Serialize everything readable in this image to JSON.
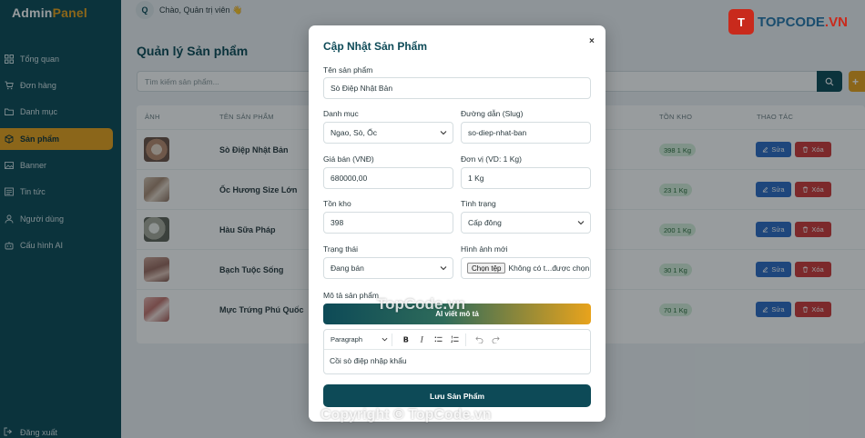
{
  "brand": {
    "part1": "Admin",
    "part2": "Panel"
  },
  "sidebar": {
    "items": [
      {
        "label": "Tổng quan",
        "icon": "grid-icon"
      },
      {
        "label": "Đơn hàng",
        "icon": "cart-icon"
      },
      {
        "label": "Danh mục",
        "icon": "folder-icon"
      },
      {
        "label": "Sản phẩm",
        "icon": "box-icon",
        "active": true
      },
      {
        "label": "Banner",
        "icon": "image-icon"
      },
      {
        "label": "Tin tức",
        "icon": "news-icon"
      },
      {
        "label": "Người dùng",
        "icon": "users-icon"
      },
      {
        "label": "Cấu hình AI",
        "icon": "robot-icon"
      }
    ],
    "logout_label": "Đăng xuất"
  },
  "header": {
    "avatar_initial": "Q",
    "greeting": "Chào, Quản trị viên 👋"
  },
  "main": {
    "title": "Quản lý Sản phẩm",
    "search_placeholder": "Tìm kiếm sản phẩm...",
    "add_label": "+",
    "columns": {
      "image": "ẢNH",
      "name": "TÊN SẢN PHẨM",
      "stock": "TỒN KHO",
      "actions": "THAO TÁC"
    },
    "edit_label": "Sửa",
    "delete_label": "Xóa",
    "rows": [
      {
        "name": "Sò Điệp Nhật Bản",
        "stock": "398 1 Kg"
      },
      {
        "name": "Ốc Hương Size Lớn",
        "stock": "23 1 Kg"
      },
      {
        "name": "Hàu Sữa Pháp",
        "stock": "200 1 Kg"
      },
      {
        "name": "Bạch Tuộc Sống",
        "stock": "30 1 Kg"
      },
      {
        "name": "Mực Trứng Phú Quốc",
        "stock": "70 1 Kg"
      }
    ]
  },
  "modal": {
    "title": "Cập Nhật Sản Phẩm",
    "close": "×",
    "name_label": "Tên sản phẩm",
    "name_value": "Sò Điệp Nhật Bản",
    "category_label": "Danh mục",
    "category_value": "Ngao, Sò, Ốc",
    "slug_label": "Đường dẫn (Slug)",
    "slug_value": "so-diep-nhat-ban",
    "price_label": "Giá bán (VNĐ)",
    "price_value": "680000,00",
    "unit_label": "Đơn vị (VD: 1 Kg)",
    "unit_value": "1 Kg",
    "stock_label": "Tồn kho",
    "stock_value": "398",
    "condition_label": "Tình trạng",
    "condition_value": "Cấp đông",
    "status_label": "Trạng thái",
    "status_value": "Đang bán",
    "image_label": "Hình ảnh mới",
    "file_button": "Chọn tệp",
    "file_text": "Không có t...được chọn",
    "desc_label": "Mô tả sản phẩm",
    "ai_button": "AI viết mô tả",
    "editor_format": "Paragraph",
    "editor_content": "Cồi sò điệp nhập khẩu",
    "save_button": "Lưu Sản Phẩm"
  },
  "watermark": {
    "logo_mark": "T",
    "logo_text": "TOPCODE",
    "logo_tld": ".VN",
    "mid_text": "TopCode.vn",
    "bottom_text": "Copyright © TopCode.vn"
  },
  "colors": {
    "sidebar": "#0d4a57",
    "accent": "#e8a31c",
    "edit": "#2d6cc4",
    "delete": "#cf3a3a"
  }
}
